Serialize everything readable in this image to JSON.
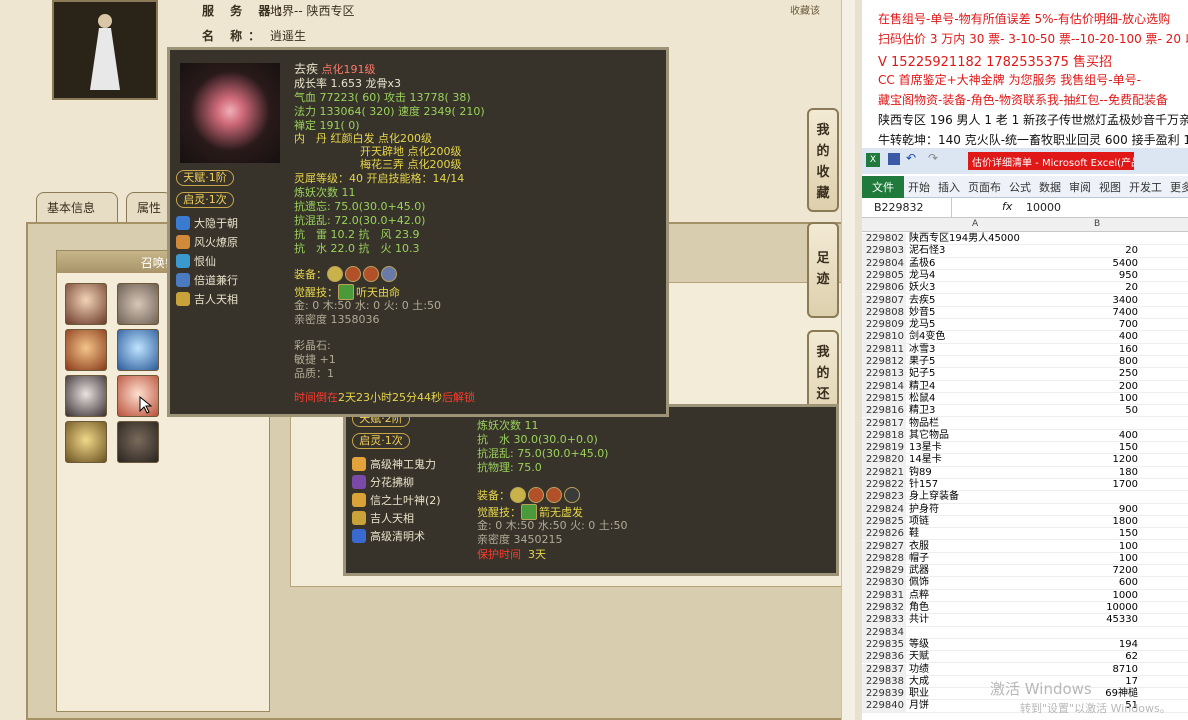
{
  "server": {
    "label": "服 务 器：",
    "value": "地界-- 陕西专区"
  },
  "name": {
    "label": "名    称：",
    "value": "逍遥生"
  },
  "fav_top": "收藏该",
  "tabs": [
    {
      "label": "基本信息"
    },
    {
      "label": "属性"
    }
  ],
  "summon_title": "召唤兽 (",
  "side_buttons": [
    {
      "label": "我的收藏"
    },
    {
      "label": "足迹"
    },
    {
      "label": "我的还价"
    }
  ],
  "tip1": {
    "name": "去疾",
    "name_suffix": "点化191级",
    "growth": "成长率 1.653  龙骨x3",
    "hp": "气血 77223( 60) 攻击 13778( 38)",
    "mp": "法力 133064( 320) 速度 2349( 210)",
    "zen": "禅定 191( 0)",
    "neidan1": "内　丹 红颜白发 点化200级",
    "neidan2": "开天辟地 点化200级",
    "neidan3": "梅花三弄 点化200级",
    "lingxi": "灵犀等级：40 开启技能格：14/14",
    "lianyao": "炼妖次数 11",
    "kang1": "抗遗忘: 75.0(30.0+45.0)",
    "kang2": "抗混乱: 72.0(30.0+42.0)",
    "kang3": "抗　雷 10.2 抗　风 23.9",
    "kang4": "抗　水 22.0 抗　火 10.3",
    "equip_label": "装备：",
    "awake_label": "觉醒技：",
    "awake_value": "听天由命",
    "elements": "金: 0 木:50 水: 0 火: 0 土:50",
    "intimacy": "亲密度 1358036",
    "crystal": "彩晶石:",
    "agility": "敏捷 +1",
    "quality": "品质：1",
    "timer_prefix": "时间倒在",
    "timer_value": "2天23小时25分44秒",
    "timer_suffix": "后解锁",
    "tag1": "天赋·1阶",
    "tag2": "启灵·1次",
    "skills": [
      "大隐于朝",
      "风火燎原",
      "恨仙",
      "倍道兼行",
      "吉人天相"
    ]
  },
  "tip2": {
    "lianyao": "炼妖次数 11",
    "kang1": "抗　水 30.0(30.0+0.0)",
    "kang2": "抗混乱: 75.0(30.0+45.0)",
    "kang3": "抗物理: 75.0",
    "equip_label": "装备：",
    "awake_label": "觉醒技：",
    "awake_value": "箭无虚发",
    "elements": "金: 0 木:50 水:50 火: 0 土:50",
    "intimacy": "亲密度 3450215",
    "protect_label": "保护时间",
    "protect_value": "3天",
    "tag1": "天赋·2阶",
    "tag2": "启灵·1次",
    "skills": [
      "高级神工鬼力",
      "分花拂柳",
      "信之土叶神(2)",
      "吉人天相",
      "高级清明术"
    ]
  },
  "top_text": [
    {
      "text": "在售组号-单号-物有所值误差 5%-有估价明细-放心选购"
    },
    {
      "text": "扫码估价 3 万内 30 票- 3-10-50 票--10-20-100 票- 20 以上 150 -"
    },
    {
      "text": "V 15225921182      1782535375   售买招"
    },
    {
      "text": "CC 首席鉴定+大神金牌         为您服务 我售组号-单号-"
    },
    {
      "text": "藏宝阁物资-装备-角色-物资联系我-抽红包--免费配装备"
    },
    {
      "text": "陕西专区 196 男人 1 老 1 新孩子传世燃灯孟极妙音千万亲密 4"
    },
    {
      "text": "牛转乾坤：140 克火队-统一畜牧职业回灵 600 接手盈利 14500"
    }
  ],
  "excel": {
    "title": "估价详细清单 - Microsoft Excel(产品...",
    "ribbon": [
      "文件",
      "开始",
      "插入",
      "页面布",
      "公式",
      "数据",
      "审阅",
      "视图",
      "开发工",
      "更多"
    ],
    "cell_ref": "B229832",
    "fx": "fx",
    "formula_value": "10000",
    "col_a": "A",
    "col_b": "B",
    "rows": [
      {
        "n": "229802",
        "a": "陕西专区194男人45000",
        "b": ""
      },
      {
        "n": "229803",
        "a": "泥石怪3",
        "b": "20"
      },
      {
        "n": "229804",
        "a": "孟极6",
        "b": "5400"
      },
      {
        "n": "229805",
        "a": "龙马4",
        "b": "950"
      },
      {
        "n": "229806",
        "a": "妖火3",
        "b": "20"
      },
      {
        "n": "229807",
        "a": "去疾5",
        "b": "3400"
      },
      {
        "n": "229808",
        "a": "妙音5",
        "b": "7400"
      },
      {
        "n": "229809",
        "a": "龙马5",
        "b": "700"
      },
      {
        "n": "229810",
        "a": "剑4变色",
        "b": "400"
      },
      {
        "n": "229811",
        "a": "冰雪3",
        "b": "160"
      },
      {
        "n": "229812",
        "a": "果子5",
        "b": "800"
      },
      {
        "n": "229813",
        "a": "妃子5",
        "b": "250"
      },
      {
        "n": "229814",
        "a": "精卫4",
        "b": "200"
      },
      {
        "n": "229815",
        "a": "松鼠4",
        "b": "100"
      },
      {
        "n": "229816",
        "a": "精卫3",
        "b": "50"
      },
      {
        "n": "229817",
        "a": "物品栏",
        "b": ""
      },
      {
        "n": "229818",
        "a": "其它物品",
        "b": "400"
      },
      {
        "n": "229819",
        "a": "13星卡",
        "b": "150"
      },
      {
        "n": "229820",
        "a": "14星卡",
        "b": "1200"
      },
      {
        "n": "229821",
        "a": "钩89",
        "b": "180"
      },
      {
        "n": "229822",
        "a": "针157",
        "b": "1700"
      },
      {
        "n": "229823",
        "a": "身上穿装备",
        "b": ""
      },
      {
        "n": "229824",
        "a": "护身符",
        "b": "900"
      },
      {
        "n": "229825",
        "a": "项链",
        "b": "1800"
      },
      {
        "n": "229826",
        "a": "鞋",
        "b": "150"
      },
      {
        "n": "229827",
        "a": "衣服",
        "b": "100"
      },
      {
        "n": "229828",
        "a": "帽子",
        "b": "100"
      },
      {
        "n": "229829",
        "a": "武器",
        "b": "7200"
      },
      {
        "n": "229830",
        "a": "佩饰",
        "b": "600"
      },
      {
        "n": "229831",
        "a": "点粹",
        "b": "1000"
      },
      {
        "n": "229832",
        "a": "角色",
        "b": "10000"
      },
      {
        "n": "229833",
        "a": "共计",
        "b": "45330"
      },
      {
        "n": "229834",
        "a": "",
        "b": ""
      },
      {
        "n": "229835",
        "a": "等级",
        "b": "194"
      },
      {
        "n": "229836",
        "a": "天赋",
        "b": "62"
      },
      {
        "n": "229837",
        "a": "功绩",
        "b": "8710"
      },
      {
        "n": "229838",
        "a": "大成",
        "b": "17"
      },
      {
        "n": "229839",
        "a": "职业",
        "b": "69神槌"
      },
      {
        "n": "229840",
        "a": "月饼",
        "b": "51"
      }
    ]
  },
  "watermark": "激活 Windows",
  "watermark2": "转到\"设置\"以激活 Windows。"
}
